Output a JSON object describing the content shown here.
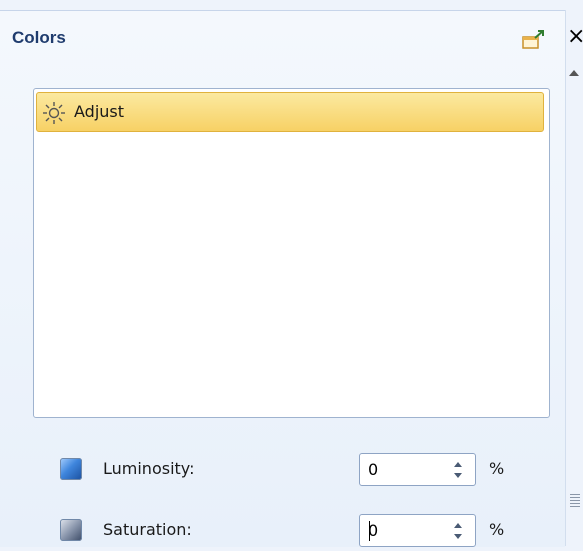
{
  "panel": {
    "title": "Colors",
    "icons": {
      "popout": "popout-window-icon",
      "close": "close-icon"
    }
  },
  "effects": {
    "items": [
      {
        "label": "Adjust",
        "icon": "sun-icon",
        "selected": true
      }
    ]
  },
  "controls": [
    {
      "label": "Luminosity:",
      "value": "0",
      "unit": "%",
      "icon": "luminosity-swatch-icon"
    },
    {
      "label": "Saturation:",
      "value": "0",
      "unit": "%",
      "icon": "saturation-swatch-icon"
    }
  ],
  "colors": {
    "selection": "#f7d165",
    "selection_border": "#e0b23d",
    "title": "#1f3c6e"
  }
}
